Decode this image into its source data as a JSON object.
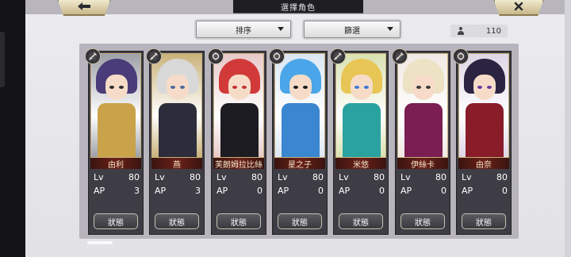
{
  "header": {
    "title": "選擇角色",
    "count": "110"
  },
  "filters": {
    "sort_label": "排序",
    "filter_label": "篩選"
  },
  "stat_labels": {
    "lv": "Lv",
    "ap": "AP"
  },
  "status_label": "狀態",
  "characters": [
    {
      "name": "由利",
      "lv": "80",
      "ap": "3",
      "weapon_icon": "sword-icon",
      "hair_color": "#4a3c78",
      "outfit_color": "#c9a24a",
      "eye_color": "#2d2d2d",
      "bg_color": "#9ea0a8"
    },
    {
      "name": "燕",
      "lv": "80",
      "ap": "3",
      "weapon_icon": "sword-icon",
      "hair_color": "#d8d8d8",
      "outfit_color": "#2c2c3a",
      "eye_color": "#4b6aa0",
      "bg_color": "#c9b27a"
    },
    {
      "name": "芙朗姆拉比絲",
      "lv": "80",
      "ap": "0",
      "weapon_icon": "magic-icon",
      "hair_color": "#d23a3a",
      "outfit_color": "#1c1c22",
      "eye_color": "#c23030",
      "bg_color": "#e7c9c9"
    },
    {
      "name": "星之子",
      "lv": "80",
      "ap": "0",
      "weapon_icon": "magic-icon",
      "hair_color": "#4aa6e8",
      "outfit_color": "#3a86d0",
      "eye_color": "#1a1a1a",
      "bg_color": "#dbe6f3"
    },
    {
      "name": "米悠",
      "lv": "80",
      "ap": "0",
      "weapon_icon": "sword-icon",
      "hair_color": "#e8c656",
      "outfit_color": "#2aa2a0",
      "eye_color": "#3a7ad0",
      "bg_color": "#d9e0b0"
    },
    {
      "name": "伊絲卡",
      "lv": "80",
      "ap": "0",
      "weapon_icon": "sword-icon",
      "hair_color": "#ede2c4",
      "outfit_color": "#7a1e54",
      "eye_color": "#3a3a3a",
      "bg_color": "#f0e8e4"
    },
    {
      "name": "由奈",
      "lv": "80",
      "ap": "0",
      "weapon_icon": "magic-icon",
      "hair_color": "#2a2440",
      "outfit_color": "#8a1c2a",
      "eye_color": "#6a3aa0",
      "bg_color": "#ded6e6"
    }
  ]
}
